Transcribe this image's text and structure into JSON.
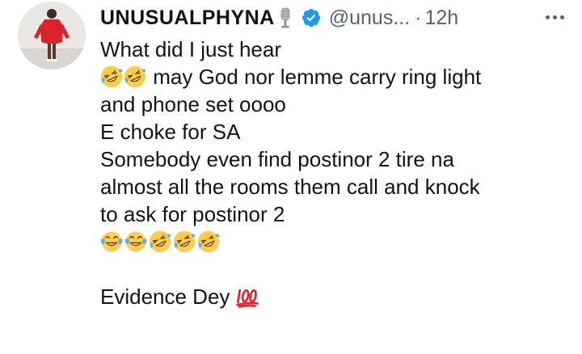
{
  "tweet": {
    "display_name": "UNUSUALPHYNA",
    "handle": "@unus...",
    "separator": "·",
    "timestamp": "12h",
    "lines": {
      "l1": "What did I just hear",
      "l2_text": "may God nor lemme carry ring light",
      "l3": "and phone set oooo",
      "l4": "E choke for SA",
      "l5": "Somebody even find postinor 2 tire na",
      "l6": "almost all the rooms them call and knock",
      "l7": "to ask for postinor 2",
      "l9_text": "Evidence Dey"
    },
    "icons": {
      "name_badge": "microphone-icon",
      "verified": "verified-badge-icon",
      "more": "more-options-icon",
      "emoji_rofl": "rolling-on-floor-laughing-emoji",
      "emoji_tears": "face-with-tears-of-joy-emoji",
      "emoji_100": "hundred-points-emoji"
    },
    "colors": {
      "verified_blue": "#1d9bf0",
      "secondary_text": "#536471",
      "primary_text": "#0f1419",
      "hundred_red": "#e0202a"
    }
  }
}
